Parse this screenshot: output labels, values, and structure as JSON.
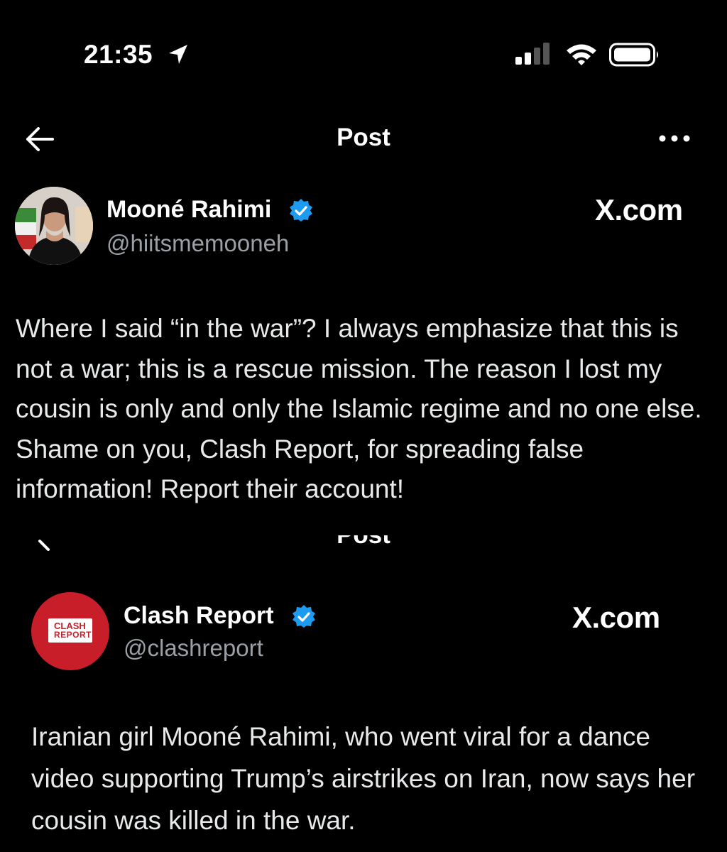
{
  "status_bar": {
    "time": "21:35",
    "icons": [
      "location-arrow-icon",
      "cellular-signal-icon",
      "wifi-icon",
      "battery-icon"
    ]
  },
  "header": {
    "title": "Post",
    "back_icon": "arrow-left-icon",
    "more_icon": "more-horizontal-icon"
  },
  "post": {
    "author_name": "Mooné Rahimi",
    "author_handle": "@hiitsmemooneh",
    "verified": true,
    "watermark": "X.com",
    "text": "Where I said “in the war”? I always emphasize that this is not a war; this is a rescue mission. The reason I lost my cousin is only and only the Islamic regime and no one else. Shame on you, Clash Report, for spreading false information! Report their account!"
  },
  "quoted_screenshot": {
    "header_title": "Post",
    "avatar_logo_line1": "CLASH",
    "avatar_logo_line2": "REPORT",
    "author_name": "Clash Report",
    "author_handle": "@clashreport",
    "verified": true,
    "watermark": "X.com",
    "text": "Iranian girl Mooné Rahimi, who went viral for a dance video supporting Trump’s airstrikes on Iran, now says her cousin was killed in the war."
  },
  "colors": {
    "background": "#000000",
    "text_primary": "#e7e9ea",
    "text_secondary": "#9aa0a6",
    "verified_badge": "#1d9bf0",
    "clash_report_red": "#c81e2a"
  }
}
